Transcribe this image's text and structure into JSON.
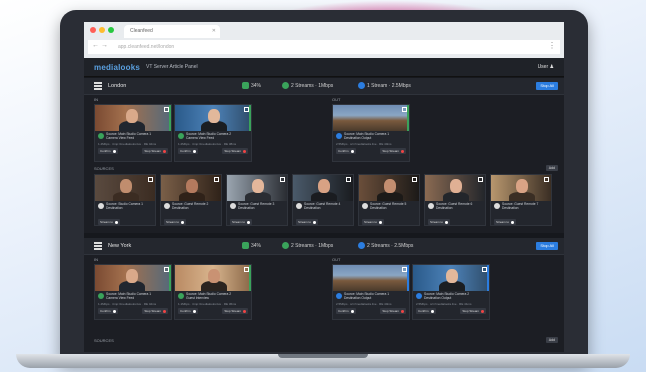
{
  "browser": {
    "tab_title": "Cleanfeed",
    "url": "app.cleanfeed.net/london",
    "traffic_colors": [
      "#ff5f57",
      "#febc2e",
      "#28c840"
    ]
  },
  "app": {
    "logo": "medialooks",
    "title": "VT Server Article Panel",
    "user": "User"
  },
  "sections": [
    {
      "name": "London",
      "stats": [
        {
          "icon": "green-square-icon",
          "text": "34%"
        },
        {
          "icon": "green-circle-icon",
          "text": "2 Streams · 1Mbps"
        },
        {
          "icon": "blue-circle-icon",
          "text": "1 Stream · 2.5Mbps"
        }
      ],
      "button": "Stop All",
      "in_label": "IN",
      "out_label": "OUT",
      "sources_label": "SOURCES",
      "sources_btn": "Add",
      "in_cards": [
        {
          "title": "Source: Main Studio Camera 1",
          "sub": "Camera View Feed",
          "line": "1.4Mbps · rtmp://medialooks.live · RE 42ms",
          "btn1": "Confirm",
          "btn2": "Stop Stream"
        },
        {
          "title": "Source: Main Studio Camera 2",
          "sub": "Camera View Feed",
          "line": "1.2Mbps · rtmp://medialooks.live · RE 38ms",
          "btn1": "Confirm",
          "btn2": "Stop Stream"
        }
      ],
      "out_cards": [
        {
          "title": "Source: Main Studio Camera 1",
          "sub": "Destination Output",
          "line": "2.5Mbps · srt://medialooks.live · RE 40ms",
          "btn1": "Confirm",
          "btn2": "Stop Stream"
        }
      ],
      "sources": [
        {
          "title": "Source: Studio Camera 1",
          "sub": "Destination"
        },
        {
          "title": "Source: Guest Remote 2",
          "sub": "Destination"
        },
        {
          "title": "Source: Guest Remote 3",
          "sub": "Destination"
        },
        {
          "title": "Source: Guest Remote 4",
          "sub": "Destination"
        },
        {
          "title": "Source: Guest Remote 5",
          "sub": "Destination"
        },
        {
          "title": "Source: Guest Remote 6",
          "sub": "Destination"
        },
        {
          "title": "Source: Guest Remote 7",
          "sub": "Destination"
        }
      ],
      "source_btn": "Stream to"
    },
    {
      "name": "New York",
      "stats": [
        {
          "icon": "green-square-icon",
          "text": "34%"
        },
        {
          "icon": "green-circle-icon",
          "text": "2 Streams · 1Mbps"
        },
        {
          "icon": "blue-circle-icon",
          "text": "2 Streams · 2.5Mbps"
        }
      ],
      "button": "Stop All",
      "in_label": "IN",
      "out_label": "OUT",
      "sources_label": "SOURCES",
      "sources_btn": "Add",
      "in_cards": [
        {
          "title": "Source: Main Studio Camera 1",
          "sub": "Camera View Feed",
          "line": "1.4Mbps · rtmp://medialooks.live · RE 42ms",
          "btn1": "Confirm",
          "btn2": "Stop Stream"
        },
        {
          "title": "Source: Main Studio Camera 2",
          "sub": "Guest Interview",
          "line": "1.1Mbps · rtmp://medialooks.live · RE 36ms",
          "btn1": "Confirm",
          "btn2": "Stop Stream"
        }
      ],
      "out_cards": [
        {
          "title": "Source: Main Studio Camera 1",
          "sub": "Destination Output",
          "line": "2.5Mbps · srt://medialooks.live · RE 40ms",
          "btn1": "Confirm",
          "btn2": "Stop Stream"
        },
        {
          "title": "Source: Main Studio Camera 2",
          "sub": "Destination Output",
          "line": "2.5Mbps · srt://medialooks.live · RE 41ms",
          "btn1": "Confirm",
          "btn2": "Stop Stream"
        }
      ]
    }
  ],
  "colors": {
    "accent": "#2b7de0",
    "green": "#3aa35b",
    "red": "#e44444",
    "bg": "#16181d"
  }
}
